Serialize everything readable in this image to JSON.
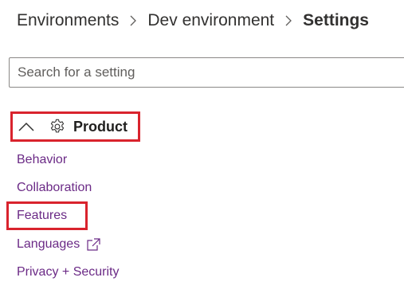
{
  "breadcrumb": {
    "items": [
      "Environments",
      "Dev environment"
    ],
    "current": "Settings"
  },
  "search": {
    "placeholder": "Search for a setting",
    "value": ""
  },
  "group": {
    "title": "Product",
    "expanded": true,
    "icon": "gear-icon",
    "links": [
      {
        "label": "Behavior"
      },
      {
        "label": "Collaboration"
      },
      {
        "label": "Features"
      },
      {
        "label": "Languages",
        "external": true
      },
      {
        "label": "Privacy + Security"
      }
    ]
  },
  "colors": {
    "link": "#6b2a86",
    "highlight": "#d9232d",
    "text": "#323130"
  }
}
